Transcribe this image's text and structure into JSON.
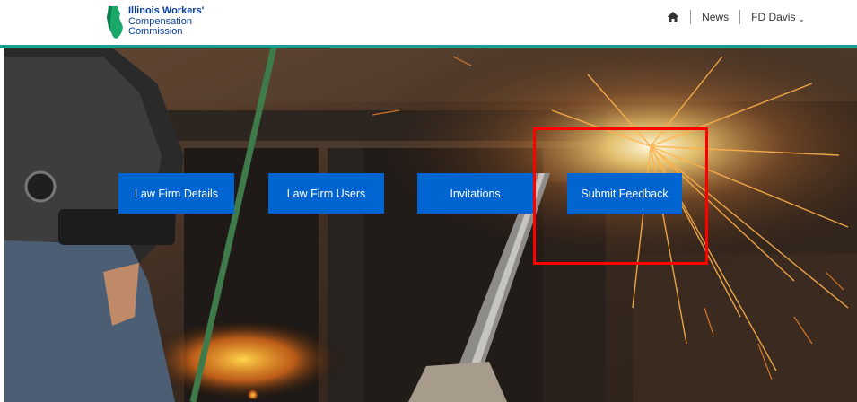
{
  "header": {
    "logo": {
      "line1": "Illinois Workers'",
      "line2": "Compensation",
      "line3": "Commission",
      "icon": "illinois-state-icon",
      "color": "#0a3f9c"
    },
    "nav": {
      "home_icon": "home-icon",
      "news_label": "News",
      "user_label": "FD Davis",
      "user_caret": "⌄"
    },
    "accent_color": "#1a9d93"
  },
  "hero": {
    "image": "welder-with-sparks-photo",
    "tiles": [
      {
        "label": "Law Firm Details"
      },
      {
        "label": "Law Firm Users"
      },
      {
        "label": "Invitations"
      },
      {
        "label": "Submit Feedback"
      }
    ],
    "tile_color": "#0065d1",
    "highlight_color": "#ff0000"
  }
}
